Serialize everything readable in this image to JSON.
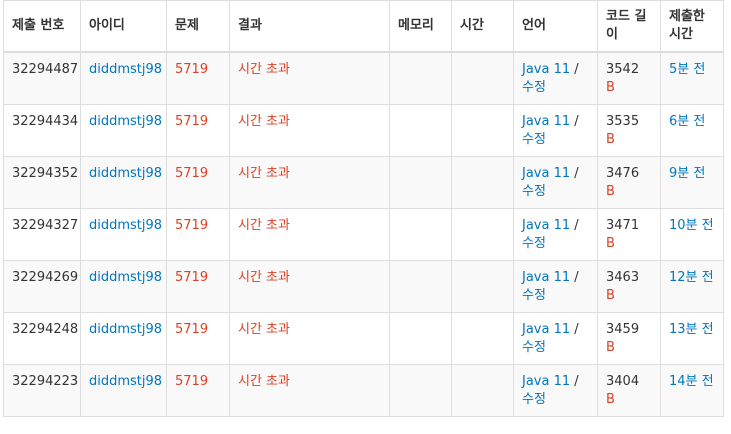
{
  "headers": [
    "제출 번호",
    "아이디",
    "문제",
    "결과",
    "메모리",
    "시간",
    "언어",
    "코드 길이",
    "제출한 시간"
  ],
  "rows": [
    {
      "id": "32294487",
      "user": "diddmstj98",
      "problem": "5719",
      "result": "시간 초과",
      "memory": "",
      "time": "",
      "lang": "Java 11",
      "edit": "수정",
      "length": "3542",
      "unit": "B",
      "submitted": "5분 전"
    },
    {
      "id": "32294434",
      "user": "diddmstj98",
      "problem": "5719",
      "result": "시간 초과",
      "memory": "",
      "time": "",
      "lang": "Java 11",
      "edit": "수정",
      "length": "3535",
      "unit": "B",
      "submitted": "6분 전"
    },
    {
      "id": "32294352",
      "user": "diddmstj98",
      "problem": "5719",
      "result": "시간 초과",
      "memory": "",
      "time": "",
      "lang": "Java 11",
      "edit": "수정",
      "length": "3476",
      "unit": "B",
      "submitted": "9분 전"
    },
    {
      "id": "32294327",
      "user": "diddmstj98",
      "problem": "5719",
      "result": "시간 초과",
      "memory": "",
      "time": "",
      "lang": "Java 11",
      "edit": "수정",
      "length": "3471",
      "unit": "B",
      "submitted": "10분 전"
    },
    {
      "id": "32294269",
      "user": "diddmstj98",
      "problem": "5719",
      "result": "시간 초과",
      "memory": "",
      "time": "",
      "lang": "Java 11",
      "edit": "수정",
      "length": "3463",
      "unit": "B",
      "submitted": "12분 전"
    },
    {
      "id": "32294248",
      "user": "diddmstj98",
      "problem": "5719",
      "result": "시간 초과",
      "memory": "",
      "time": "",
      "lang": "Java 11",
      "edit": "수정",
      "length": "3459",
      "unit": "B",
      "submitted": "13분 전"
    },
    {
      "id": "32294223",
      "user": "diddmstj98",
      "problem": "5719",
      "result": "시간 초과",
      "memory": "",
      "time": "",
      "lang": "Java 11",
      "edit": "수정",
      "length": "3404",
      "unit": "B",
      "submitted": "14분 전"
    }
  ],
  "colors": {
    "link": "#0076c0",
    "error": "#dd4124",
    "border": "#dddddd",
    "stripe": "#f9f9f9"
  }
}
